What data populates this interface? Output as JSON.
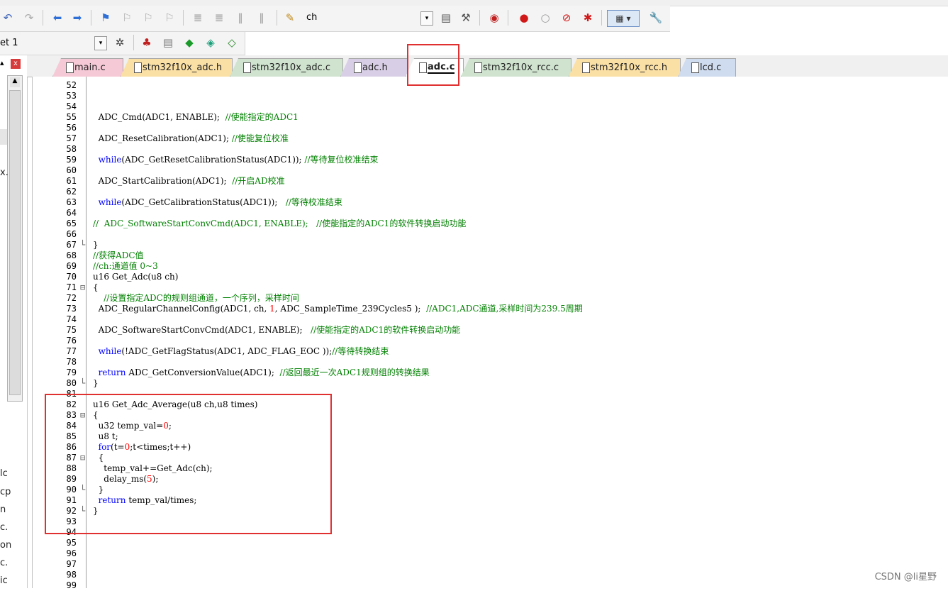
{
  "toolbar": {
    "find_text": "ch"
  },
  "target_select": {
    "value": "et 1"
  },
  "left_panel": {
    "close_label": "x",
    "fragments": [
      "x.",
      "lc",
      "cp",
      "n",
      "c.",
      "on",
      "c.",
      "ic"
    ]
  },
  "tabs": [
    {
      "label": "main.c",
      "color": "#f5c9d6"
    },
    {
      "label": "stm32f10x_adc.h",
      "color": "#fbe0a5"
    },
    {
      "label": "stm32f10x_adc.c",
      "color": "#cfe3cf"
    },
    {
      "label": "adc.h",
      "color": "#d8cfe6"
    },
    {
      "label": "adc.c",
      "color": "#ffffff",
      "active": true
    },
    {
      "label": "stm32f10x_rcc.c",
      "color": "#cfe3cf"
    },
    {
      "label": "stm32f10x_rcc.h",
      "color": "#fbe0a5"
    },
    {
      "label": "lcd.c",
      "color": "#cfdcef"
    }
  ],
  "code": [
    {
      "n": "52",
      "fold": "",
      "seg": []
    },
    {
      "n": "53",
      "fold": "",
      "seg": []
    },
    {
      "n": "54",
      "fold": "",
      "seg": []
    },
    {
      "n": "55",
      "fold": "",
      "seg": [
        {
          "t": "  ADC_Cmd(ADC1, ENABLE);  ",
          "c": "p"
        },
        {
          "t": "//使能指定的ADC1",
          "c": "cm"
        }
      ]
    },
    {
      "n": "56",
      "fold": "",
      "seg": []
    },
    {
      "n": "57",
      "fold": "",
      "seg": [
        {
          "t": "  ADC_ResetCalibration(ADC1); ",
          "c": "p"
        },
        {
          "t": "//使能复位校准",
          "c": "cm"
        }
      ]
    },
    {
      "n": "58",
      "fold": "",
      "seg": []
    },
    {
      "n": "59",
      "fold": "",
      "seg": [
        {
          "t": "  ",
          "c": "p"
        },
        {
          "t": "while",
          "c": "kw"
        },
        {
          "t": "(ADC_GetResetCalibrationStatus(ADC1)); ",
          "c": "p"
        },
        {
          "t": "//等待复位校准结束",
          "c": "cm"
        }
      ]
    },
    {
      "n": "60",
      "fold": "",
      "seg": []
    },
    {
      "n": "61",
      "fold": "",
      "seg": [
        {
          "t": "  ADC_StartCalibration(ADC1);  ",
          "c": "p"
        },
        {
          "t": "//开启AD校准",
          "c": "cm"
        }
      ]
    },
    {
      "n": "62",
      "fold": "",
      "seg": []
    },
    {
      "n": "63",
      "fold": "",
      "seg": [
        {
          "t": "  ",
          "c": "p"
        },
        {
          "t": "while",
          "c": "kw"
        },
        {
          "t": "(ADC_GetCalibrationStatus(ADC1));   ",
          "c": "p"
        },
        {
          "t": "//等待校准结束",
          "c": "cm"
        }
      ]
    },
    {
      "n": "64",
      "fold": "",
      "seg": []
    },
    {
      "n": "65",
      "fold": "",
      "seg": [
        {
          "t": "//  ADC_SoftwareStartConvCmd(ADC1, ENABLE);   //使能指定的ADC1的软件转换启动功能",
          "c": "cm"
        }
      ]
    },
    {
      "n": "66",
      "fold": "",
      "seg": []
    },
    {
      "n": "67",
      "fold": "└",
      "seg": [
        {
          "t": "}",
          "c": "p"
        }
      ]
    },
    {
      "n": "68",
      "fold": "",
      "seg": [
        {
          "t": "//获得ADC值",
          "c": "cm"
        }
      ]
    },
    {
      "n": "69",
      "fold": "",
      "seg": [
        {
          "t": "//ch:通道值 0~3",
          "c": "cm"
        }
      ]
    },
    {
      "n": "70",
      "fold": "",
      "seg": [
        {
          "t": "u16 Get_Adc(u8 ch)",
          "c": "p"
        }
      ]
    },
    {
      "n": "71",
      "fold": "⊟",
      "seg": [
        {
          "t": "{",
          "c": "p"
        }
      ]
    },
    {
      "n": "72",
      "fold": "",
      "seg": [
        {
          "t": "    //设置指定ADC的规则组通道，一个序列，采样时间",
          "c": "cm"
        }
      ]
    },
    {
      "n": "73",
      "fold": "",
      "seg": [
        {
          "t": "  ADC_RegularChannelConfig(ADC1, ch, ",
          "c": "p"
        },
        {
          "t": "1",
          "c": "num"
        },
        {
          "t": ", ADC_SampleTime_239Cycles5 );  ",
          "c": "p"
        },
        {
          "t": "//ADC1,ADC通道,采样时间为239.5周期",
          "c": "cm"
        }
      ]
    },
    {
      "n": "74",
      "fold": "",
      "seg": []
    },
    {
      "n": "75",
      "fold": "",
      "seg": [
        {
          "t": "  ADC_SoftwareStartConvCmd(ADC1, ENABLE);   ",
          "c": "p"
        },
        {
          "t": "//使能指定的ADC1的软件转换启动功能",
          "c": "cm"
        }
      ]
    },
    {
      "n": "76",
      "fold": "",
      "seg": []
    },
    {
      "n": "77",
      "fold": "",
      "seg": [
        {
          "t": "  ",
          "c": "p"
        },
        {
          "t": "while",
          "c": "kw"
        },
        {
          "t": "(!ADC_GetFlagStatus(ADC1, ADC_FLAG_EOC ));",
          "c": "p"
        },
        {
          "t": "//等待转换结束",
          "c": "cm"
        }
      ]
    },
    {
      "n": "78",
      "fold": "",
      "seg": []
    },
    {
      "n": "79",
      "fold": "",
      "seg": [
        {
          "t": "  ",
          "c": "p"
        },
        {
          "t": "return",
          "c": "kw"
        },
        {
          "t": " ADC_GetConversionValue(ADC1);  ",
          "c": "p"
        },
        {
          "t": "//返回最近一次ADC1规则组的转换结果",
          "c": "cm"
        }
      ]
    },
    {
      "n": "80",
      "fold": "└",
      "seg": [
        {
          "t": "}",
          "c": "p"
        }
      ]
    },
    {
      "n": "81",
      "fold": "",
      "seg": []
    },
    {
      "n": "82",
      "fold": "",
      "seg": [
        {
          "t": "u16 Get_Adc_Average(u8 ch,u8 times)",
          "c": "p"
        }
      ]
    },
    {
      "n": "83",
      "fold": "⊟",
      "seg": [
        {
          "t": "{",
          "c": "p"
        }
      ]
    },
    {
      "n": "84",
      "fold": "",
      "seg": [
        {
          "t": "  u32 temp_val=",
          "c": "p"
        },
        {
          "t": "0",
          "c": "num"
        },
        {
          "t": ";",
          "c": "p"
        }
      ]
    },
    {
      "n": "85",
      "fold": "",
      "seg": [
        {
          "t": "  u8 t;",
          "c": "p"
        }
      ]
    },
    {
      "n": "86",
      "fold": "",
      "seg": [
        {
          "t": "  ",
          "c": "p"
        },
        {
          "t": "for",
          "c": "kw"
        },
        {
          "t": "(t=",
          "c": "p"
        },
        {
          "t": "0",
          "c": "num"
        },
        {
          "t": ";t<times;t++)",
          "c": "p"
        }
      ]
    },
    {
      "n": "87",
      "fold": "⊟",
      "seg": [
        {
          "t": "  {",
          "c": "p"
        }
      ]
    },
    {
      "n": "88",
      "fold": "",
      "seg": [
        {
          "t": "    temp_val+=Get_Adc(ch);",
          "c": "p"
        }
      ]
    },
    {
      "n": "89",
      "fold": "",
      "seg": [
        {
          "t": "    delay_ms(",
          "c": "p"
        },
        {
          "t": "5",
          "c": "num"
        },
        {
          "t": ");",
          "c": "p"
        }
      ]
    },
    {
      "n": "90",
      "fold": "└",
      "seg": [
        {
          "t": "  }",
          "c": "p"
        }
      ]
    },
    {
      "n": "91",
      "fold": "",
      "seg": [
        {
          "t": "  ",
          "c": "p"
        },
        {
          "t": "return",
          "c": "kw"
        },
        {
          "t": " temp_val/times;",
          "c": "p"
        }
      ]
    },
    {
      "n": "92",
      "fold": "└",
      "seg": [
        {
          "t": "}",
          "c": "p"
        }
      ]
    },
    {
      "n": "93",
      "fold": "",
      "seg": []
    },
    {
      "n": "94",
      "fold": "",
      "seg": []
    },
    {
      "n": "95",
      "fold": "",
      "seg": []
    },
    {
      "n": "96",
      "fold": "",
      "seg": []
    },
    {
      "n": "97",
      "fold": "",
      "seg": []
    },
    {
      "n": "98",
      "fold": "",
      "seg": []
    },
    {
      "n": "99",
      "fold": "",
      "seg": []
    }
  ],
  "watermark": "CSDN @li星野"
}
